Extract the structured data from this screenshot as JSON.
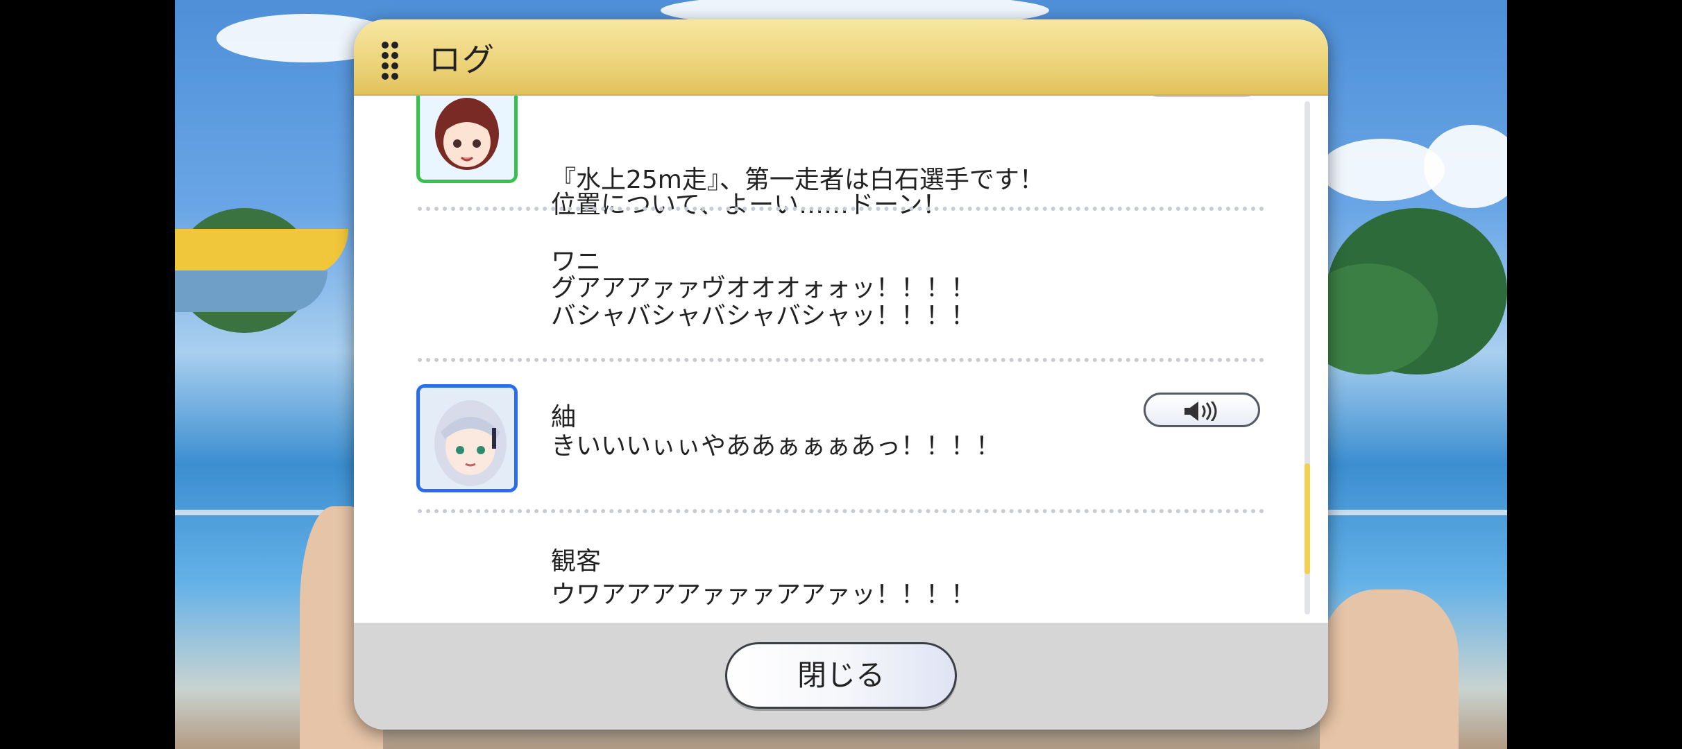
{
  "dialog": {
    "title": "ログ",
    "close_label": "閉じる"
  },
  "log": [
    {
      "speaker": "",
      "lines": [
        "『水上25m走』、第一走者は白石選手です！",
        "位置について、よーい……ドーン！"
      ],
      "avatar": "girl-red-hair-avatar",
      "avatar_border_color": "#37c24e",
      "has_voice": true
    },
    {
      "speaker": "ワニ",
      "lines": [
        "グアアアァァヴオオオォォッ！！！！",
        "バシャバシャバシャバシャッ！！！！"
      ],
      "avatar": null,
      "has_voice": false
    },
    {
      "speaker": "紬",
      "lines": [
        "きいいいぃぃやああぁぁぁあっ！！！！"
      ],
      "avatar": "girl-silver-hair-avatar",
      "avatar_border_color": "#2a6cf0",
      "has_voice": true
    },
    {
      "speaker": "観客",
      "lines": [
        "ウワアアアアァァァアアァッ！！！！"
      ],
      "avatar": null,
      "has_voice": false
    }
  ],
  "scrollbar": {
    "thumb_color": "#f2cf55",
    "position_fraction": 0.85
  },
  "colors": {
    "header_gold": "#ecd37a",
    "footer_gray": "#d6d6d6"
  }
}
